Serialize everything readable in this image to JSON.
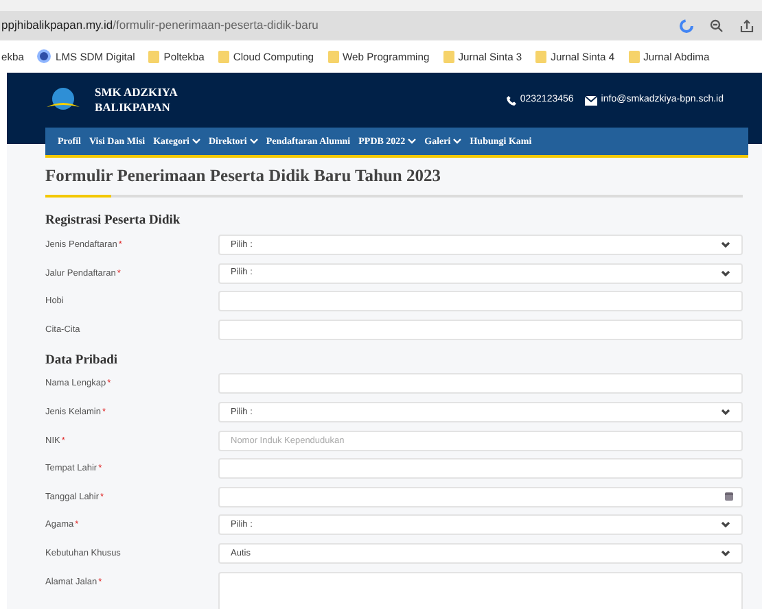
{
  "browser": {
    "url_host": "ppjhibalikpapan.my.id",
    "url_path": "/formulir-penerimaan-peserta-didik-baru",
    "bookmarks": [
      {
        "label": "ekba",
        "kind": "cut"
      },
      {
        "label": "LMS SDM Digital",
        "kind": "site"
      },
      {
        "label": "Poltekba",
        "kind": "folder"
      },
      {
        "label": "Cloud Computing",
        "kind": "folder"
      },
      {
        "label": "Web Programming",
        "kind": "folder"
      },
      {
        "label": "Jurnal Sinta 3",
        "kind": "folder"
      },
      {
        "label": "Jurnal Sinta 4",
        "kind": "folder"
      },
      {
        "label": "Jurnal Abdima",
        "kind": "folder"
      }
    ]
  },
  "header": {
    "school_name": [
      "SMK ADZKIYA",
      "BALIKPAPAN"
    ],
    "phone": "0232123456",
    "email": "info@smkadzkiya-bpn.sch.id"
  },
  "nav": [
    {
      "label": "Profil",
      "dropdown": false
    },
    {
      "label": "Visi Dan Misi",
      "dropdown": false
    },
    {
      "label": "Kategori",
      "dropdown": true
    },
    {
      "label": "Direktori",
      "dropdown": true
    },
    {
      "label": "Pendaftaran Alumni",
      "dropdown": false
    },
    {
      "label": "PPDB 2022",
      "dropdown": true
    },
    {
      "label": "Galeri",
      "dropdown": true
    },
    {
      "label": "Hubungi Kami",
      "dropdown": false
    }
  ],
  "form": {
    "title": "Formulir Penerimaan Peserta Didik Baru Tahun 2023",
    "sections": [
      {
        "heading": "Registrasi Peserta Didik",
        "fields": [
          {
            "label": "Jenis Pendaftaran",
            "required_mark": "*",
            "kind": "select",
            "value": "Pilih :"
          },
          {
            "label": "Jalur Pendaftaran",
            "required_mark": "*",
            "kind": "select",
            "value": "Pilih :"
          },
          {
            "label": "Hobi",
            "kind": "text"
          },
          {
            "label": "Cita-Cita",
            "kind": "text"
          }
        ]
      },
      {
        "heading": "Data Pribadi",
        "fields": [
          {
            "label": "Nama Lengkap",
            "required_mark": "*",
            "kind": "text"
          },
          {
            "label": "Jenis Kelamin",
            "required_mark": "*",
            "kind": "select",
            "value": "Pilih :"
          },
          {
            "label": "NIK",
            "required_mark": "*",
            "kind": "text",
            "placeholder": "Nomor Induk Kependudukan"
          },
          {
            "label": "Tempat Lahir",
            "required_mark": "*",
            "kind": "text"
          },
          {
            "label": "Tanggal Lahir",
            "required_mark": "*",
            "kind": "date"
          },
          {
            "label": "Agama",
            "required_mark": "*",
            "kind": "select",
            "value": "Pilih :"
          },
          {
            "label": "Kebutuhan Khusus",
            "kind": "select",
            "value": "Autis"
          },
          {
            "label": "Alamat Jalan",
            "required_mark": "*",
            "kind": "textarea"
          }
        ]
      }
    ]
  }
}
